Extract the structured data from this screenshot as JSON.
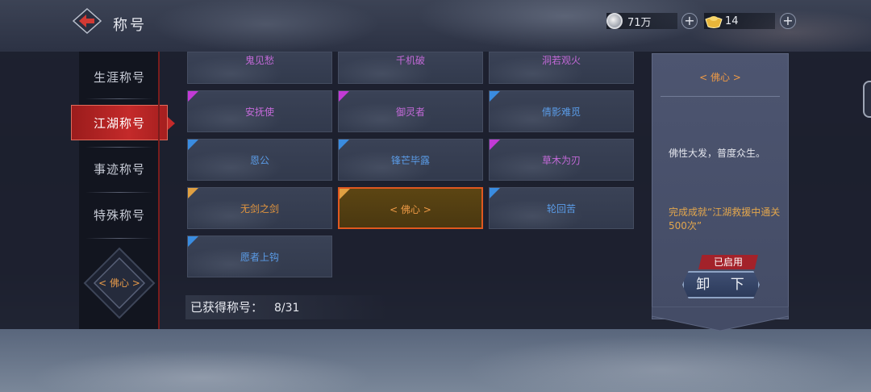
{
  "header": {
    "title": "称号",
    "silver": "71万",
    "gold": "14"
  },
  "sidebar": {
    "items": [
      {
        "label": "生涯称号",
        "active": false
      },
      {
        "label": "江湖称号",
        "active": true
      },
      {
        "label": "事迹称号",
        "active": false
      },
      {
        "label": "特殊称号",
        "active": false
      }
    ],
    "equipped_badge": "< 佛心 >"
  },
  "titles": [
    {
      "name": "鬼见愁",
      "color": "#c46ad9",
      "flag": "",
      "row": "cut"
    },
    {
      "name": "千机破",
      "color": "#c46ad9",
      "flag": "",
      "row": "cut"
    },
    {
      "name": "洞若观火",
      "color": "#c46ad9",
      "flag": "",
      "row": "cut"
    },
    {
      "name": "安抚使",
      "color": "#c46ad9",
      "flag": "#c23ad6"
    },
    {
      "name": "御灵者",
      "color": "#c46ad9",
      "flag": "#c23ad6"
    },
    {
      "name": "倩影难觅",
      "color": "#5a9be6",
      "flag": "#3a8ce0"
    },
    {
      "name": "恩公",
      "color": "#5a9be6",
      "flag": "#3a8ce0"
    },
    {
      "name": "锋芒毕露",
      "color": "#5a9be6",
      "flag": "#3a8ce0"
    },
    {
      "name": "草木为刃",
      "color": "#c46ad9",
      "flag": "#c23ad6"
    },
    {
      "name": "无剑之剑",
      "color": "#e0943e",
      "flag": "#e0a042"
    },
    {
      "name": "< 佛心 >",
      "color": "#ee9a46",
      "flag": "#e0a042",
      "selected": true
    },
    {
      "name": "轮回苦",
      "color": "#5a9be6",
      "flag": "#3a8ce0"
    },
    {
      "name": "愿者上钩",
      "color": "#5a9be6",
      "flag": "#3a8ce0"
    }
  ],
  "obtained": {
    "label": "已获得称号：",
    "count": "8/31"
  },
  "detail": {
    "name": "< 佛心 >",
    "description": "佛性大发，普度众生。",
    "condition": "完成成就“江湖救援中通关500次”",
    "enabled_tag": "已启用",
    "action_button": "卸 下"
  },
  "colors": {
    "accent_red": "#c42a2a",
    "selected_border": "#e0581f",
    "orange_text": "#ee9a46",
    "purple_text": "#c46ad9",
    "blue_text": "#5a9be6"
  }
}
